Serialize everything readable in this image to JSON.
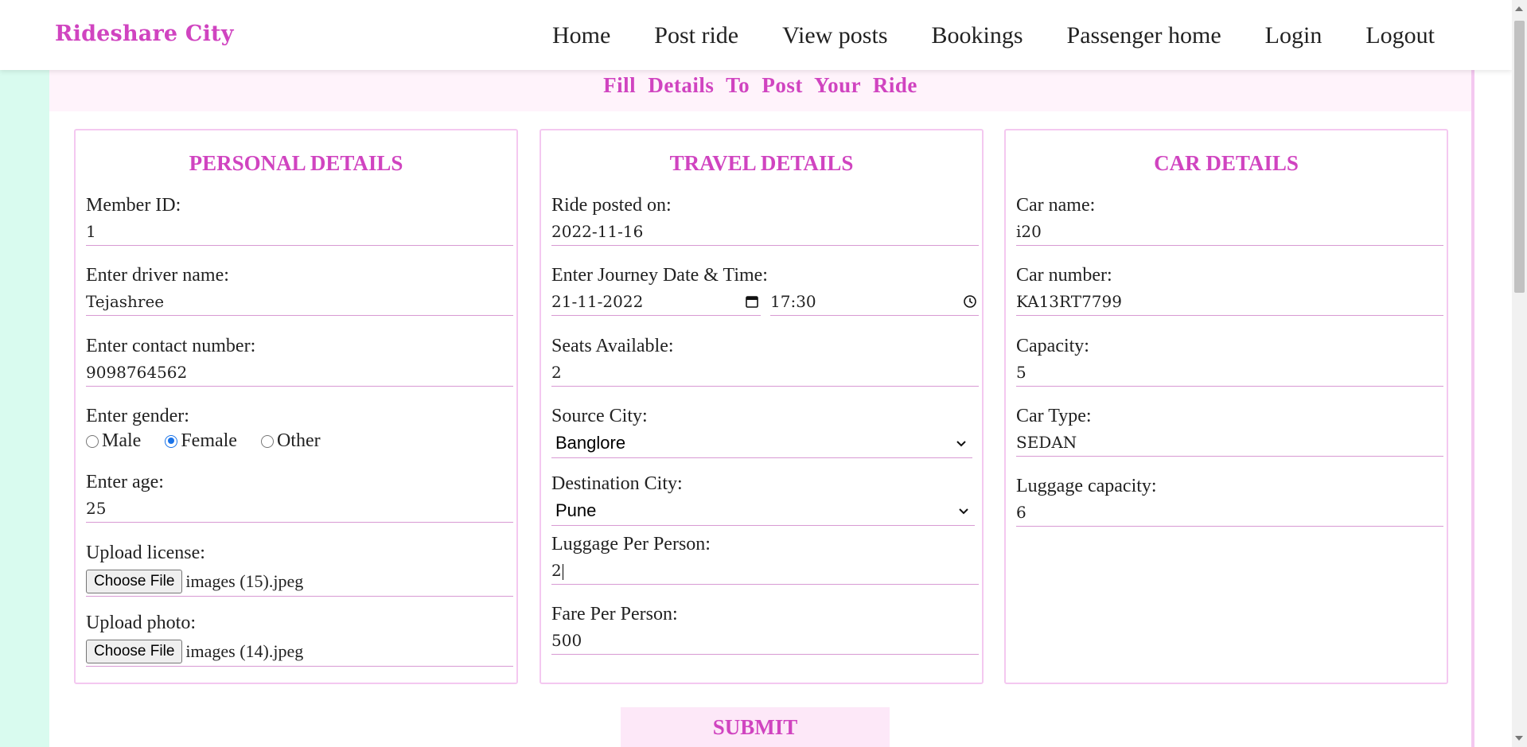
{
  "header": {
    "brand": "Rideshare City",
    "nav": [
      "Home",
      "Post ride",
      "View posts",
      "Bookings",
      "Passenger home",
      "Login",
      "Logout"
    ]
  },
  "page_title": "Fill Details To Post Your Ride",
  "personal": {
    "title": "PERSONAL DETAILS",
    "member_id_label": "Member ID:",
    "member_id": "1",
    "driver_name_label": "Enter driver name:",
    "driver_name": "Tejashree",
    "contact_label": "Enter contact number:",
    "contact": "9098764562",
    "gender_label": "Enter gender:",
    "gender_options": [
      "Male",
      "Female",
      "Other"
    ],
    "gender_selected": "Female",
    "age_label": "Enter age:",
    "age": "25",
    "license_label": "Upload license:",
    "license_button": "Choose File",
    "license_file": "images (15).jpeg",
    "photo_label": "Upload photo:",
    "photo_button": "Choose File",
    "photo_file": "images (14).jpeg"
  },
  "travel": {
    "title": "TRAVEL DETAILS",
    "posted_on_label": "Ride posted on:",
    "posted_on": "2022-11-16",
    "journey_label": "Enter Journey Date & Time:",
    "journey_date": "21-11-2022",
    "journey_time": "17:30",
    "seats_label": "Seats Available:",
    "seats": "2",
    "source_label": "Source City:",
    "source": "Banglore",
    "destination_label": "Destination City:",
    "destination": "Pune",
    "luggage_label": "Luggage Per Person:",
    "luggage": "2",
    "fare_label": "Fare Per Person:",
    "fare": "500"
  },
  "car": {
    "title": "CAR DETAILS",
    "name_label": "Car name:",
    "name": "i20",
    "number_label": "Car number:",
    "number": "KA13RT7799",
    "capacity_label": "Capacity:",
    "capacity": "5",
    "type_label": "Car Type:",
    "type": "SEDAN",
    "luggage_label": "Luggage capacity:",
    "luggage": "6"
  },
  "submit_label": "SUBMIT",
  "colors": {
    "accent": "#d044c0",
    "field_underline": "#d89ad3",
    "card_border": "#f4c8f0",
    "stripe": "#d9fbef",
    "submit_bg": "#fde8f8"
  }
}
